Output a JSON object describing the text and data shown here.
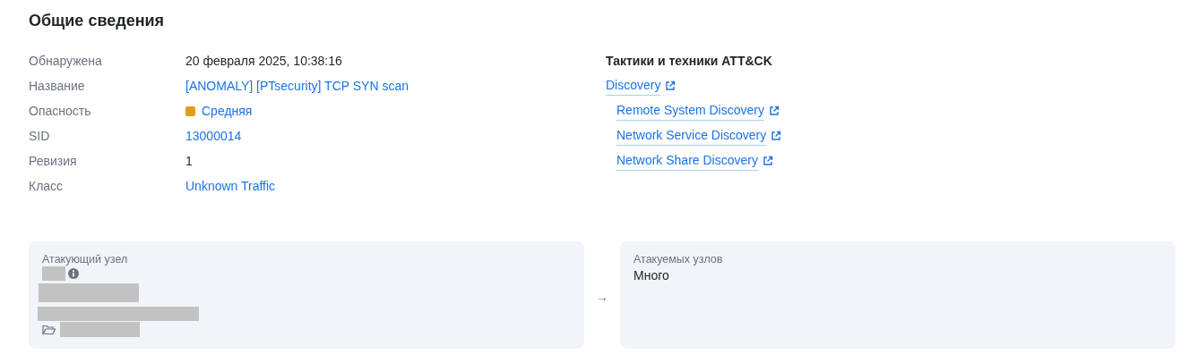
{
  "title": "Общие сведения",
  "fields": [
    {
      "label": "Обнаружена",
      "value": "20 февраля 2025, 10:38:16",
      "kind": "text"
    },
    {
      "label": "Название",
      "value": "[ANOMALY] [PTsecurity] TCP SYN scan",
      "kind": "link"
    },
    {
      "label": "Опасность",
      "value": "Средняя",
      "kind": "severity",
      "color": "#e09e1e"
    },
    {
      "label": "SID",
      "value": "13000014",
      "kind": "link"
    },
    {
      "label": "Ревизия",
      "value": "1",
      "kind": "text"
    },
    {
      "label": "Класс",
      "value": "Unknown Traffic",
      "kind": "link"
    }
  ],
  "attack": {
    "title": "Тактики и техники ATT&CK",
    "tactics": [
      {
        "name": "Discovery",
        "children": [
          {
            "name": "Remote System Discovery"
          },
          {
            "name": "Network Service Discovery"
          },
          {
            "name": "Network Share Discovery"
          }
        ]
      }
    ]
  },
  "attacker": {
    "label": "Атакующий узел"
  },
  "arrow": "→",
  "targets": {
    "label": "Атакуемых узлов",
    "value": "Много"
  }
}
